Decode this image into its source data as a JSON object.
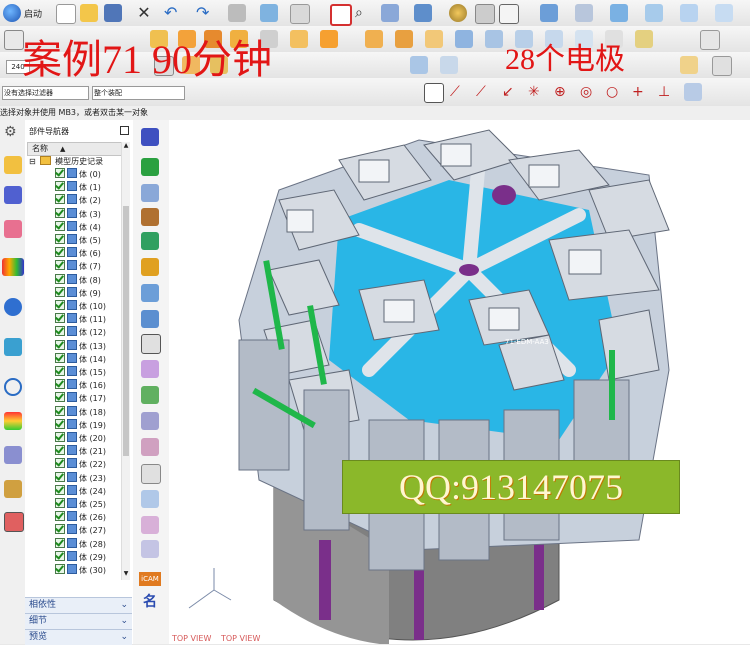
{
  "watermark": {
    "title": "案例71  90分钟",
    "electrodes": "28个电极",
    "contact": "QQ:913147075"
  },
  "toolbar": {
    "start_label": "启动",
    "zoom_value": "240",
    "filter_select": "没有选择过滤器",
    "assembly_select": "整个装配"
  },
  "message": "选择对象并使用 MB3，或者双击某一对象",
  "navigator": {
    "title": "部件导航器",
    "column_name": "名称",
    "root": "模型历史记录",
    "items": [
      "体 (0)",
      "体 (1)",
      "体 (2)",
      "体 (3)",
      "体 (4)",
      "体 (5)",
      "体 (6)",
      "体 (7)",
      "体 (8)",
      "体 (9)",
      "体 (10)",
      "体 (11)",
      "体 (12)",
      "体 (13)",
      "体 (14)",
      "体 (15)",
      "体 (16)",
      "体 (17)",
      "体 (18)",
      "体 (19)",
      "体 (20)",
      "体 (21)",
      "体 (22)",
      "体 (23)",
      "体 (24)",
      "体 (25)",
      "体 (26)",
      "体 (27)",
      "体 (28)",
      "体 (29)",
      "体 (30)"
    ],
    "sections": [
      "相依性",
      "细节",
      "预览"
    ]
  },
  "viewport": {
    "label_left": "TOP VIEW",
    "label_right": "TOP VIEW",
    "part_label": "71-EDM-AA3"
  },
  "iconstrip": {
    "icam_label": "iCAM",
    "name_label": "名"
  }
}
